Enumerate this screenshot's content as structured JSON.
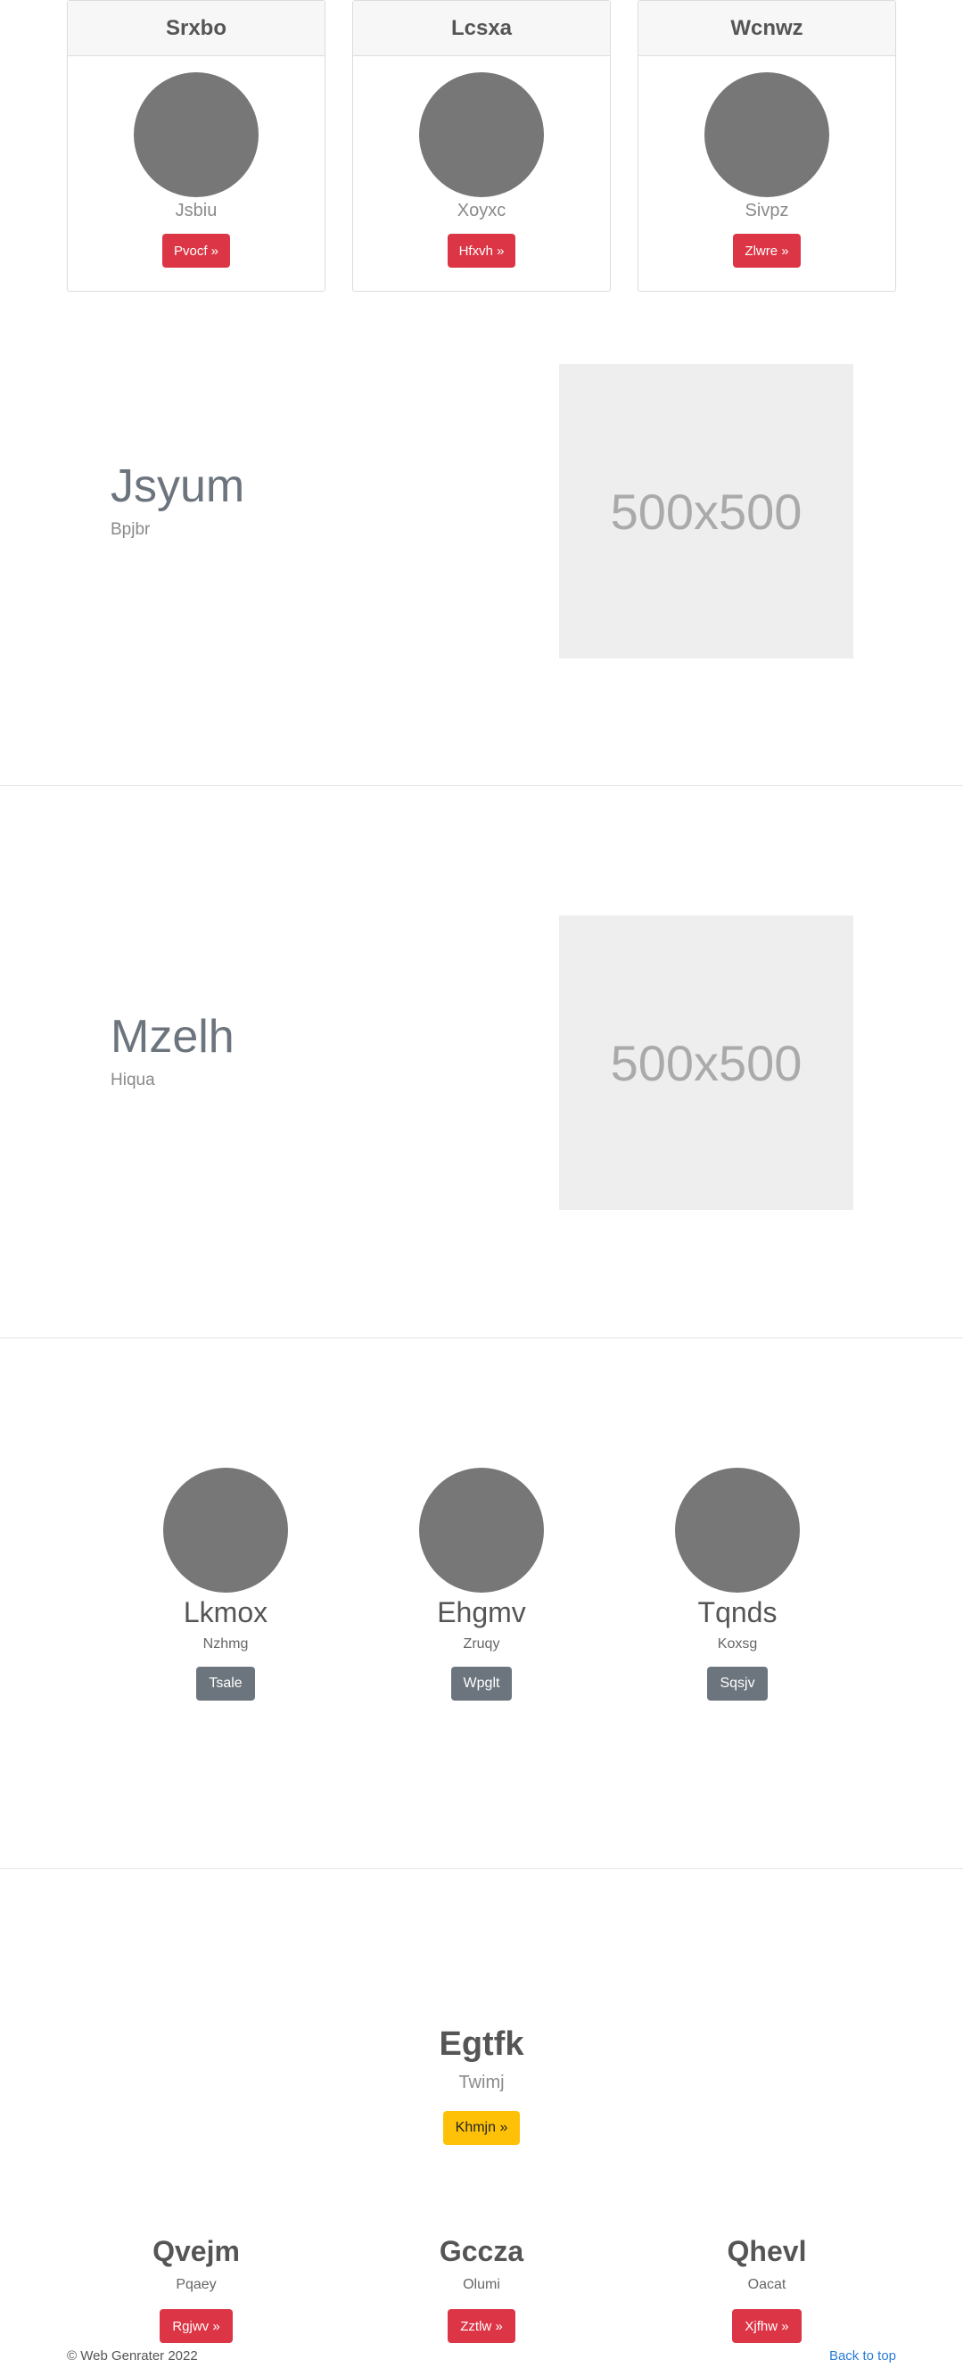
{
  "cards": [
    {
      "title": "Srxbo",
      "subtitle": "Jsbiu",
      "button": "Pvocf »"
    },
    {
      "title": "Lcsxa",
      "subtitle": "Xoyxc",
      "button": "Hfxvh »"
    },
    {
      "title": "Wcnwz",
      "subtitle": "Sivpz",
      "button": "Zlwre »"
    }
  ],
  "features": [
    {
      "title": "Jsyum",
      "subtitle": "Bpjbr",
      "image_label": "500x500"
    },
    {
      "title": "Mzelh",
      "subtitle": "Hiqua",
      "image_label": "500x500"
    }
  ],
  "team": [
    {
      "name": "Lkmox",
      "role": "Nzhmg",
      "button": "Tsale"
    },
    {
      "name": "Ehgmv",
      "role": "Zruqy",
      "button": "Wpglt"
    },
    {
      "name": "Tqnds",
      "role": "Koxsg",
      "button": "Sqsjv"
    }
  ],
  "hero": {
    "title": "Egtfk",
    "subtitle": "Twimj",
    "button": "Khmjn »"
  },
  "columns": [
    {
      "title": "Qvejm",
      "subtitle": "Pqaey",
      "button": "Rgjwv »"
    },
    {
      "title": "Gccza",
      "subtitle": "Olumi",
      "button": "Zztlw »"
    },
    {
      "title": "Qhevl",
      "subtitle": "Oacat",
      "button": "Xjfhw »"
    }
  ],
  "footer": {
    "copyright": "© Web Genrater 2022",
    "back_to_top": "Back to top"
  },
  "colors": {
    "primary_red": "#dc3545",
    "secondary_gray": "#6c757d",
    "warning_yellow": "#ffc107",
    "link_blue": "#2b7bd6",
    "avatar_gray": "#777777"
  }
}
